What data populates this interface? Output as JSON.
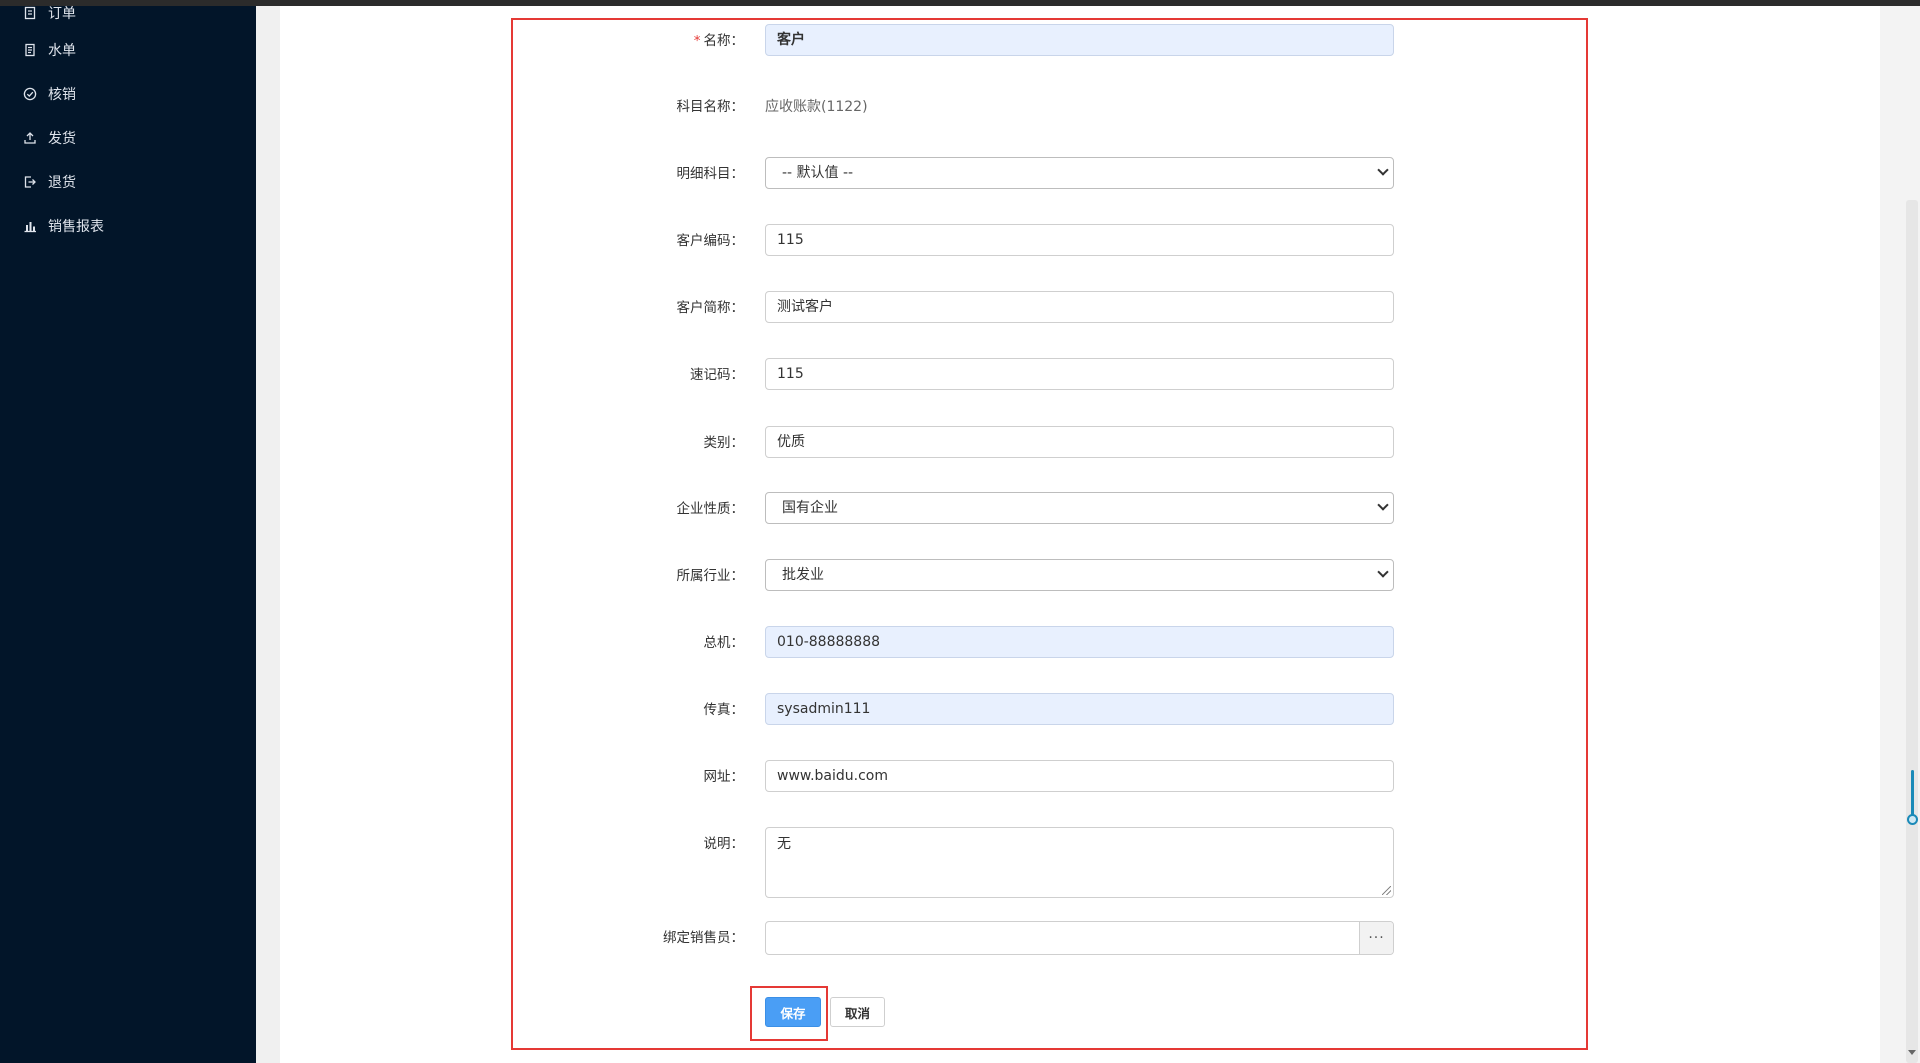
{
  "sidebar": {
    "items": [
      {
        "label": "订单",
        "icon": "file-icon"
      },
      {
        "label": "水单",
        "icon": "receipt-icon"
      },
      {
        "label": "核销",
        "icon": "check-circle-icon"
      },
      {
        "label": "发货",
        "icon": "upload-icon"
      },
      {
        "label": "退货",
        "icon": "logout-icon"
      },
      {
        "label": "销售报表",
        "icon": "bar-chart-icon"
      }
    ]
  },
  "form": {
    "required_mark": "*",
    "name": {
      "label": "名称：",
      "value": "客户"
    },
    "account_subject": {
      "label": "科目名称：",
      "value": "应收账款(1122)"
    },
    "detail_subject": {
      "label": "明细科目：",
      "value": "-- 默认值 --"
    },
    "customer_code": {
      "label": "客户编码：",
      "value": "115"
    },
    "short_name": {
      "label": "客户简称：",
      "value": "测试客户"
    },
    "quick_code": {
      "label": "速记码：",
      "value": "115"
    },
    "category": {
      "label": "类别：",
      "value": "优质"
    },
    "enterprise_type": {
      "label": "企业性质：",
      "value": "国有企业"
    },
    "industry": {
      "label": "所属行业：",
      "value": "批发业"
    },
    "phone": {
      "label": "总机：",
      "value": "010-88888888"
    },
    "fax": {
      "label": "传真：",
      "value": "sysadmin111"
    },
    "website": {
      "label": "网址：",
      "value": "www.baidu.com"
    },
    "remark": {
      "label": "说明：",
      "value": "无"
    },
    "salesperson": {
      "label": "绑定销售员：",
      "value": "",
      "picker_label": "···"
    }
  },
  "actions": {
    "save_label": "保存",
    "cancel_label": "取消"
  },
  "colors": {
    "sidebar_bg": "#021529",
    "highlight": "#e53935",
    "primary": "#4a9ef5",
    "autofill_bg": "#e8f0fe"
  }
}
